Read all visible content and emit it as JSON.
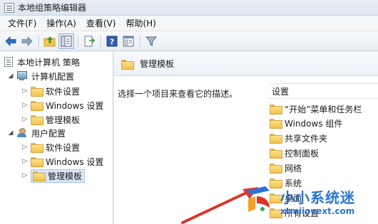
{
  "window": {
    "title": "本地组策略编辑器"
  },
  "menu": {
    "items": [
      "文件(F)",
      "操作(A)",
      "查看(V)",
      "帮助(H)"
    ]
  },
  "toolbar": {
    "buttons": [
      "back-icon",
      "forward-icon",
      "up-folder-icon",
      "show-hide-tree-icon",
      "export-list-icon",
      "help-icon",
      "properties-icon",
      "filter-icon"
    ]
  },
  "tree": {
    "root": "本地计算机 策略",
    "computer_config": {
      "label": "计算机配置",
      "children": [
        "软件设置",
        "Windows 设置",
        "管理模板"
      ]
    },
    "user_config": {
      "label": "用户配置",
      "children": [
        "软件设置",
        "Windows 设置",
        "管理模板"
      ]
    },
    "selected": "用户配置 > 管理模板"
  },
  "main": {
    "title": "管理模板",
    "description": "选择一个项目来查看它的描述。",
    "column_header": "设置",
    "items": [
      "“开始”菜单和任务栏",
      "Windows 组件",
      "共享文件夹",
      "控制面板",
      "网络",
      "系统",
      "桌面",
      "所有设置"
    ]
  },
  "watermark": {
    "name": "小小系统迷",
    "url": "xtmiiovext.com"
  },
  "colors": {
    "accent": "#2a75d6",
    "arrow": "#e0322a",
    "selection": "#d8e6f6"
  }
}
